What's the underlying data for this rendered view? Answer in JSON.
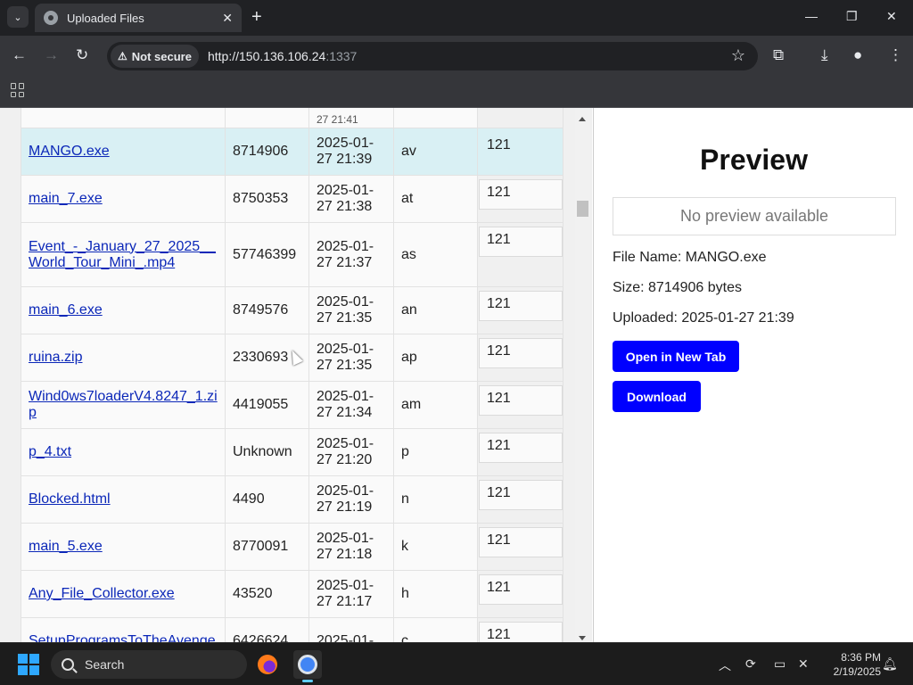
{
  "browser": {
    "tab_title": "Uploaded Files",
    "security_label": "Not secure",
    "url_host": "http://150.136.106.24",
    "url_port": ":1337"
  },
  "table": {
    "partial_top_date": "27 21:41",
    "rows": [
      {
        "name": "MANGO.exe",
        "size": "8714906",
        "date": "2025-01-27 21:39",
        "tag": "av",
        "count": "121",
        "selected": true
      },
      {
        "name": "main_7.exe",
        "size": "8750353",
        "date": "2025-01-27 21:38",
        "tag": "at",
        "count": "121"
      },
      {
        "name": "Event_-_January_27_2025__World_Tour_Mini_.mp4",
        "size": "57746399",
        "date": "2025-01-27 21:37",
        "tag": "as",
        "count": "121"
      },
      {
        "name": "main_6.exe",
        "size": "8749576",
        "date": "2025-01-27 21:35",
        "tag": "an",
        "count": "121"
      },
      {
        "name": "ruina.zip",
        "size": "2330693",
        "date": "2025-01-27 21:35",
        "tag": "ap",
        "count": "121"
      },
      {
        "name": "Wind0ws7loaderV4.8247_1.zip",
        "size": "4419055",
        "date": "2025-01-27 21:34",
        "tag": "am",
        "count": "121"
      },
      {
        "name": "p_4.txt",
        "size": "Unknown",
        "date": "2025-01-27 21:20",
        "tag": "p",
        "count": "121"
      },
      {
        "name": "Blocked.html",
        "size": "4490",
        "date": "2025-01-27 21:19",
        "tag": "n",
        "count": "121"
      },
      {
        "name": "main_5.exe",
        "size": "8770091",
        "date": "2025-01-27 21:18",
        "tag": "k",
        "count": "121"
      },
      {
        "name": "Any_File_Collector.exe",
        "size": "43520",
        "date": "2025-01-27 21:17",
        "tag": "h",
        "count": "121"
      },
      {
        "name": "SetupProgramsToTheAvenge",
        "size": "6426624",
        "date": "2025-01-",
        "tag": "c",
        "count": "121"
      }
    ]
  },
  "preview": {
    "title": "Preview",
    "no_preview": "No preview available",
    "file_name": "File Name: MANGO.exe",
    "size": "Size: 8714906 bytes",
    "uploaded": "Uploaded: 2025-01-27 21:39",
    "open_button": "Open in New Tab",
    "download_button": "Download"
  },
  "taskbar": {
    "search_label": "Search",
    "time": "8:36 PM",
    "date": "2/19/2025"
  },
  "colors": {
    "selected_row": "#d9f0f4",
    "button_blue": "#0000ff",
    "link": "#0b27b8"
  }
}
